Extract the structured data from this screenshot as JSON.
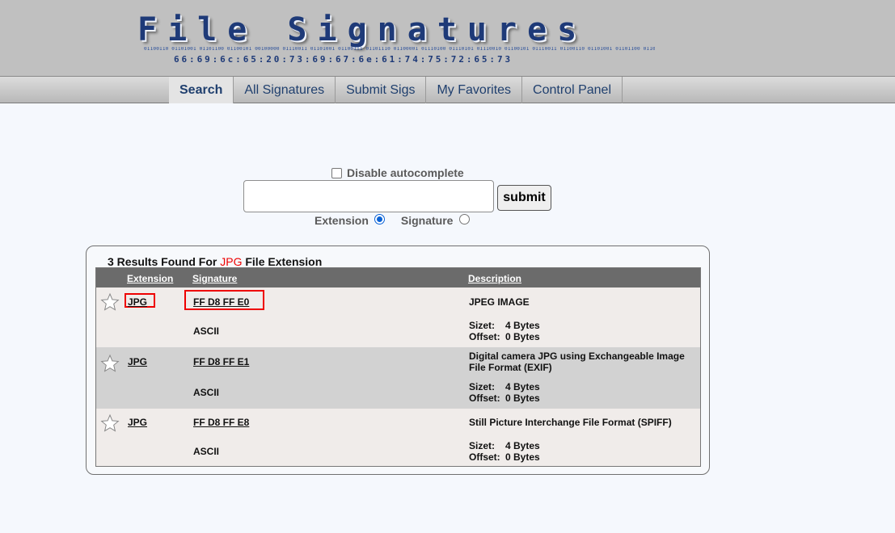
{
  "header": {
    "logo_title": "File Signatures",
    "logo_binary": "01100110 01101001 01101100 01100101 00100000 01110011 01101001 01100111 01101110 01100001 01110100 01110101 01110010 01100101 01110011 01100110 01101001 01101100 01100101",
    "logo_hex": "66:69:6c:65:20:73:69:67:6e:61:74:75:72:65:73"
  },
  "nav": {
    "items": [
      {
        "label": "Search",
        "active": true
      },
      {
        "label": "All Signatures",
        "active": false
      },
      {
        "label": "Submit Sigs",
        "active": false
      },
      {
        "label": "My Favorites",
        "active": false
      },
      {
        "label": "Control Panel",
        "active": false
      }
    ]
  },
  "search": {
    "disable_autocomplete_label": "Disable autocomplete",
    "disable_autocomplete_checked": false,
    "query_value": "",
    "submit_label": "submit",
    "extension_label": "Extension",
    "signature_label": "Signature",
    "selected_mode": "Extension"
  },
  "results": {
    "heading_prefix": "3 Results Found For ",
    "heading_term": "JPG",
    "heading_suffix": " File Extension",
    "columns": [
      "Extension",
      "Signature",
      "Description"
    ],
    "rows": [
      {
        "extension": "JPG",
        "signature": "FF D8 FF E0",
        "ascii": "ASCII",
        "description": "JPEG IMAGE",
        "size_label": "Sizet:",
        "size_value": "4 Bytes",
        "offset_label": "Offset:",
        "offset_value": "0 Bytes"
      },
      {
        "extension": "JPG",
        "signature": "FF D8 FF E1",
        "ascii": "ASCII",
        "description": "Digital camera JPG using Exchangeable Image File Format (EXIF)",
        "size_label": "Sizet:",
        "size_value": "4 Bytes",
        "offset_label": "Offset:",
        "offset_value": "0 Bytes"
      },
      {
        "extension": "JPG",
        "signature": "FF D8 FF E8",
        "ascii": "ASCII",
        "description": "Still Picture Interchange File Format (SPIFF)",
        "size_label": "Sizet:",
        "size_value": "4 Bytes",
        "offset_label": "Offset:",
        "offset_value": "0 Bytes"
      }
    ]
  },
  "colors": {
    "highlight_red": "#e00000",
    "nav_text": "#1f3f6e",
    "logo_blue": "#1e3a78"
  }
}
